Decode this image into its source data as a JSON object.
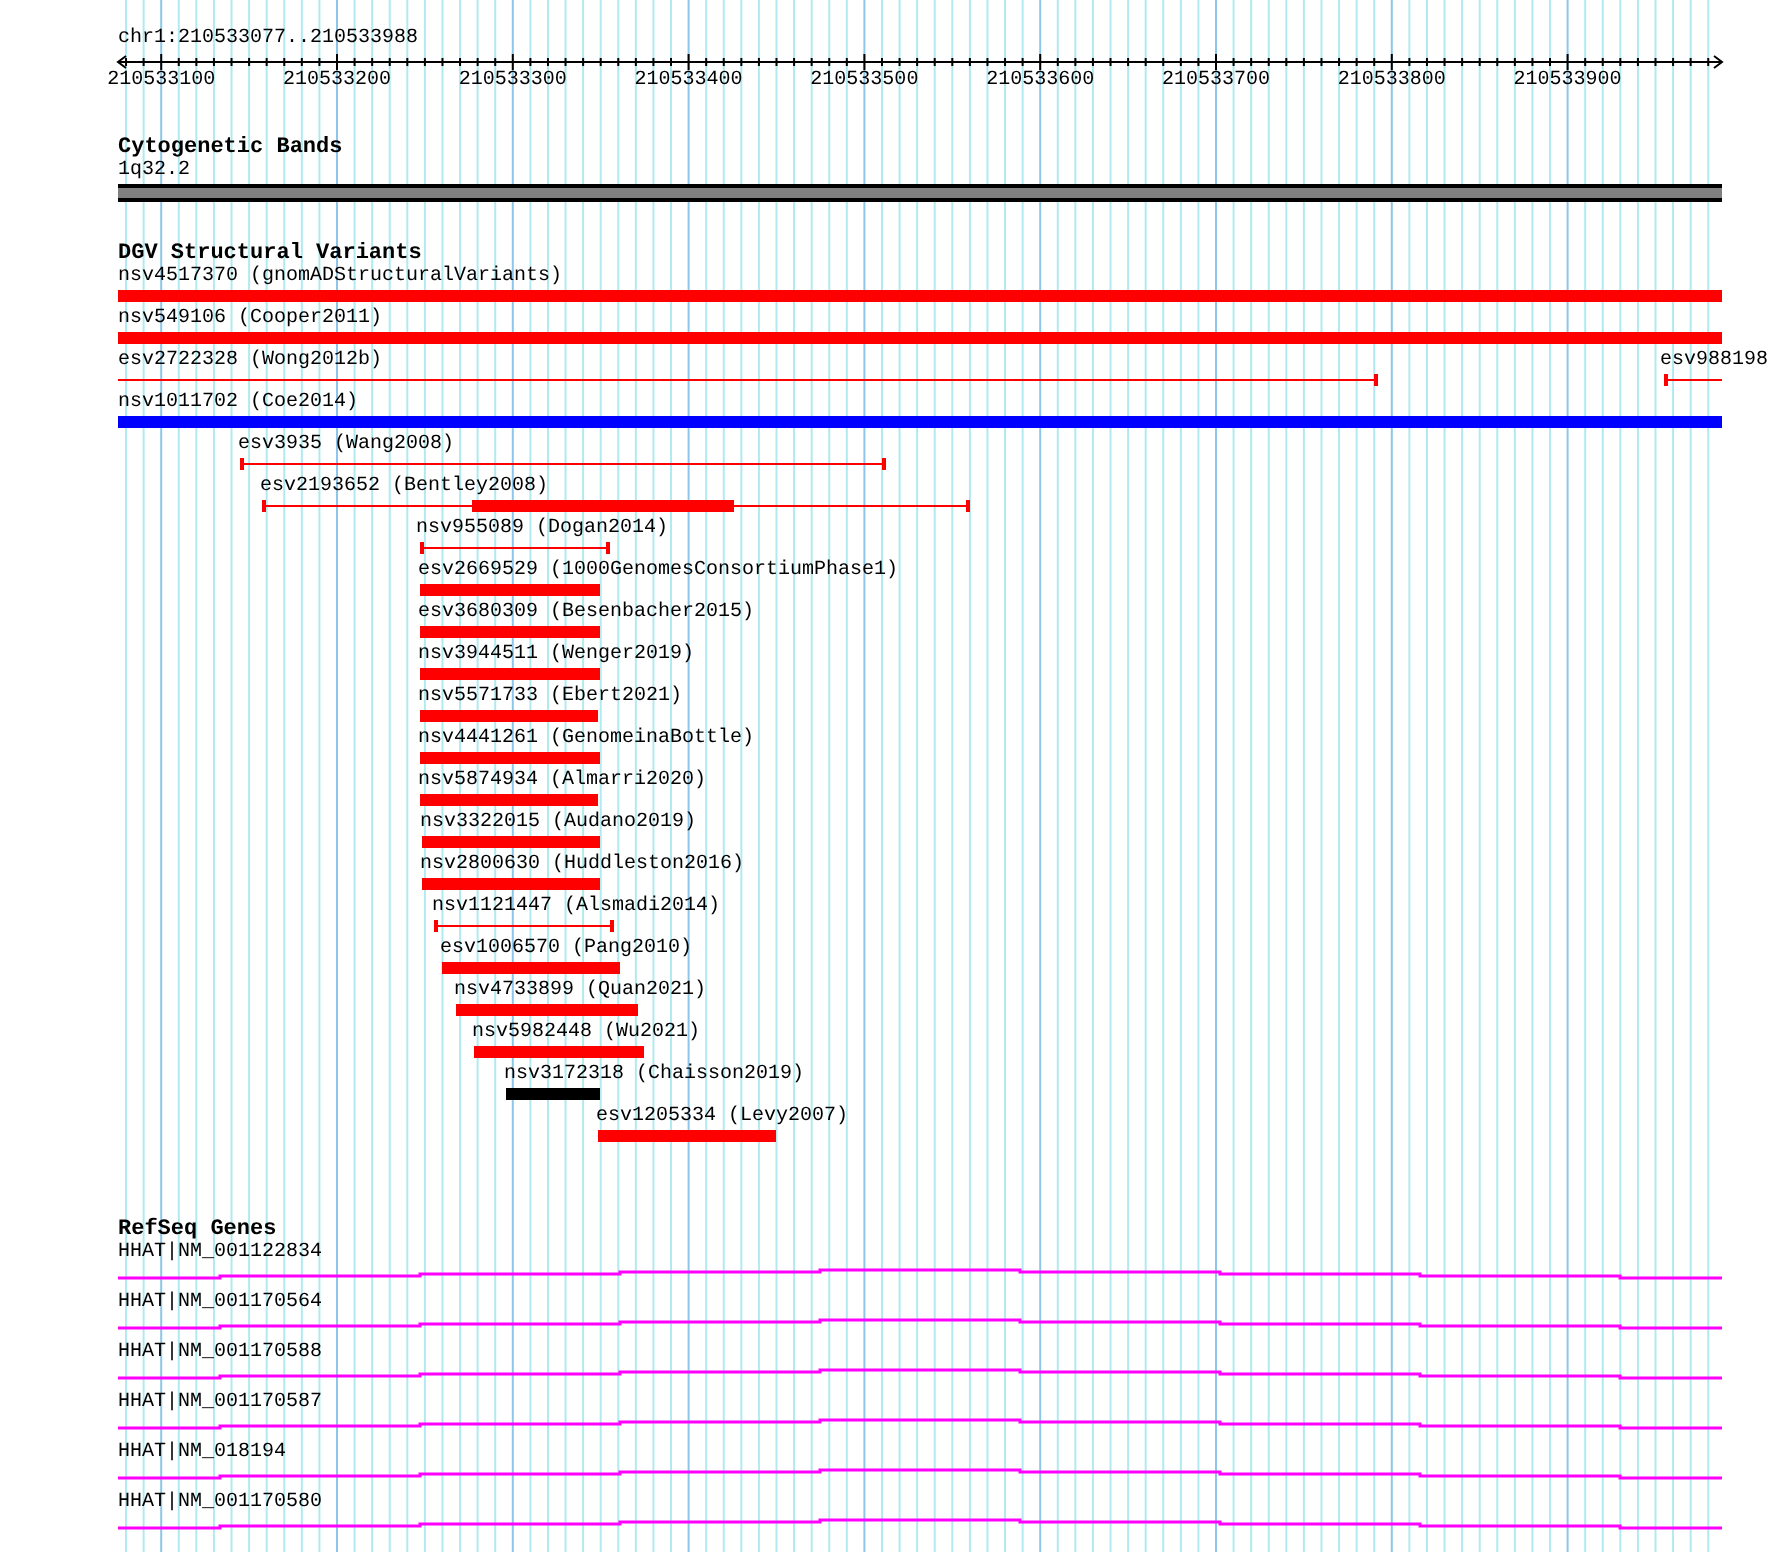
{
  "location": "chr1:210533077..210533988",
  "ruler": {
    "ticks": [
      "210533100",
      "210533200",
      "210533300",
      "210533400",
      "210533500",
      "210533600",
      "210533700",
      "210533800",
      "210533900"
    ]
  },
  "cytogenetic_bands": {
    "title": "Cytogenetic Bands",
    "band": "1q32.2"
  },
  "dgv_structural_variants": {
    "title": "DGV Structural Variants",
    "variants": [
      {
        "label": "nsv4517370 (gnomADStructuralVariants)",
        "kind": "bar",
        "color": "#ff0000"
      },
      {
        "label": "nsv549106 (Cooper2011)",
        "kind": "bar",
        "color": "#ff0000"
      },
      {
        "label": "esv2722328 (Wong2012b)",
        "kind": "span",
        "color": "#ff0000"
      },
      {
        "label": "esv988198",
        "kind": "span",
        "color": "#ff0000"
      },
      {
        "label": "nsv1011702 (Coe2014)",
        "kind": "bar",
        "color": "#0000ff"
      },
      {
        "label": "esv3935 (Wang2008)",
        "kind": "span",
        "color": "#ff0000"
      },
      {
        "label": "esv2193652 (Bentley2008)",
        "kind": "bar_in_span",
        "color": "#ff0000"
      },
      {
        "label": "nsv955089 (Dogan2014)",
        "kind": "span",
        "color": "#ff0000"
      },
      {
        "label": "esv2669529 (1000GenomesConsortiumPhase1)",
        "kind": "bar",
        "color": "#ff0000"
      },
      {
        "label": "esv3680309 (Besenbacher2015)",
        "kind": "bar",
        "color": "#ff0000"
      },
      {
        "label": "nsv3944511 (Wenger2019)",
        "kind": "bar",
        "color": "#ff0000"
      },
      {
        "label": "nsv5571733 (Ebert2021)",
        "kind": "bar",
        "color": "#ff0000"
      },
      {
        "label": "nsv4441261 (GenomeinaBottle)",
        "kind": "bar",
        "color": "#ff0000"
      },
      {
        "label": "nsv5874934 (Almarri2020)",
        "kind": "bar",
        "color": "#ff0000"
      },
      {
        "label": "nsv3322015 (Audano2019)",
        "kind": "bar",
        "color": "#ff0000"
      },
      {
        "label": "nsv2800630 (Huddleston2016)",
        "kind": "bar",
        "color": "#ff0000"
      },
      {
        "label": "nsv1121447 (Alsmadi2014)",
        "kind": "span",
        "color": "#ff0000"
      },
      {
        "label": "esv1006570 (Pang2010)",
        "kind": "bar",
        "color": "#ff0000"
      },
      {
        "label": "nsv4733899 (Quan2021)",
        "kind": "bar",
        "color": "#ff0000"
      },
      {
        "label": "nsv5982448 (Wu2021)",
        "kind": "bar",
        "color": "#ff0000"
      },
      {
        "label": "nsv3172318 (Chaisson2019)",
        "kind": "bar",
        "color": "#000000"
      },
      {
        "label": "esv1205334 (Levy2007)",
        "kind": "bar",
        "color": "#ff0000"
      }
    ]
  },
  "refseq_genes": {
    "title": "RefSeq Genes",
    "genes": [
      {
        "label": "HHAT|NM_001122834"
      },
      {
        "label": "HHAT|NM_001170564"
      },
      {
        "label": "HHAT|NM_001170588"
      },
      {
        "label": "HHAT|NM_001170587"
      },
      {
        "label": "HHAT|NM_018194"
      },
      {
        "label": "HHAT|NM_001170580"
      }
    ]
  }
}
